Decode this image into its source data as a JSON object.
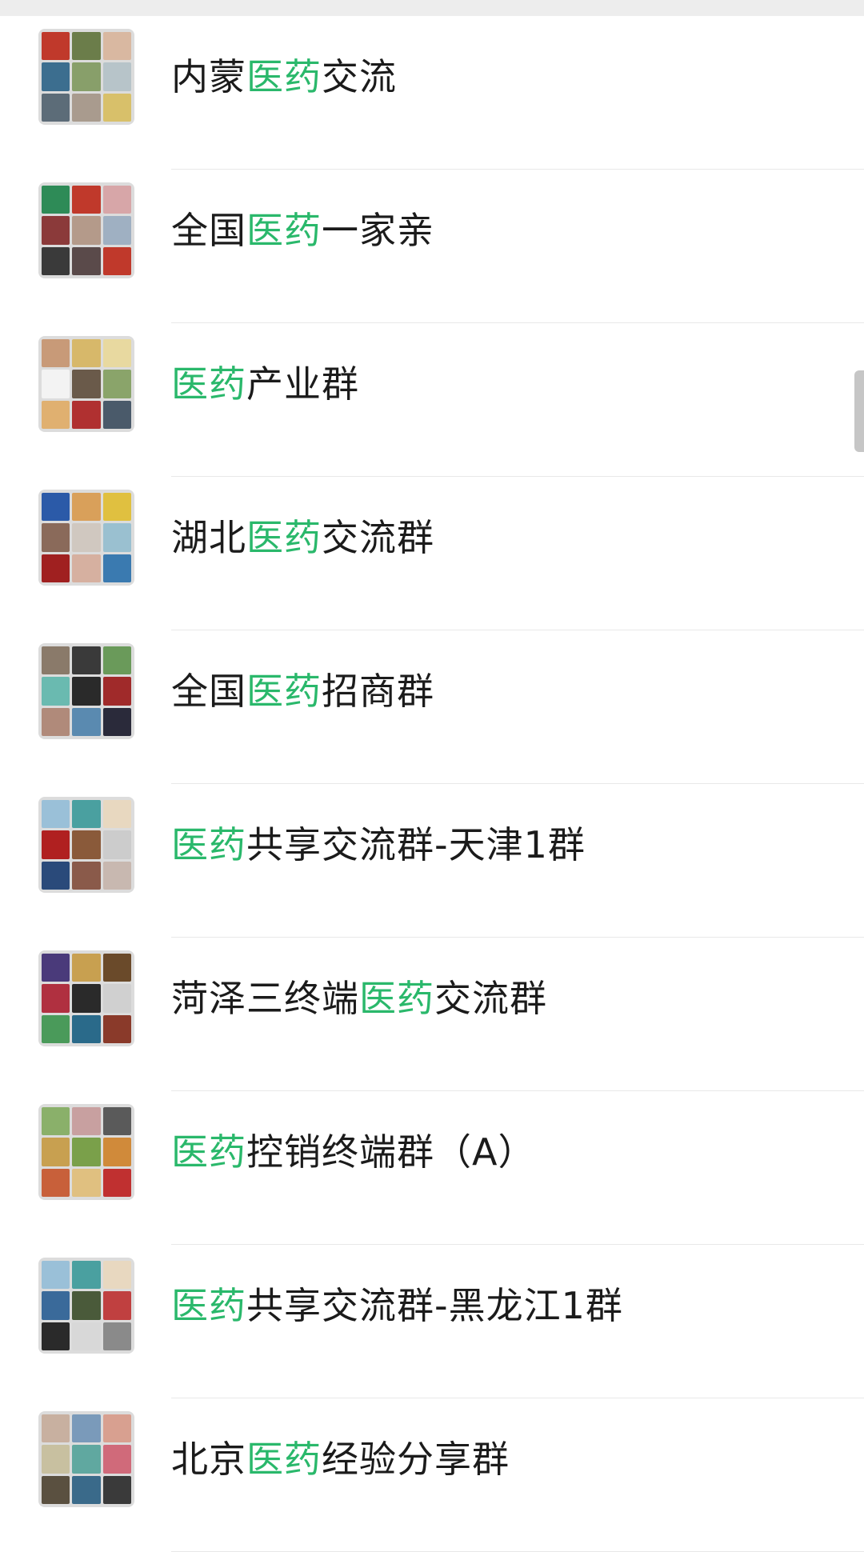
{
  "groups": [
    {
      "pre": "内蒙",
      "hl": "医药",
      "post": "交流",
      "colors": [
        "#c0392b",
        "#6b7d4a",
        "#d9b8a1",
        "#3c6e8f",
        "#889f6a",
        "#b7c4c9",
        "#5c6c78",
        "#a99b8e",
        "#d8c06a"
      ]
    },
    {
      "pre": "全国",
      "hl": "医药",
      "post": "一家亲",
      "colors": [
        "#2e8b57",
        "#c0392b",
        "#d7a6a8",
        "#8b3a3a",
        "#b49a8a",
        "#9fb0c2",
        "#3a3a3a",
        "#5a4a4a",
        "#c0392b"
      ]
    },
    {
      "pre": "",
      "hl": "医药",
      "post": "产业群",
      "colors": [
        "#c89a78",
        "#d7b86a",
        "#e8d9a0",
        "#f3f3f3",
        "#6a5a4a",
        "#8aa46a",
        "#e0b070",
        "#b03030",
        "#4a5a6a"
      ]
    },
    {
      "pre": "湖北",
      "hl": "医药",
      "post": "交流群",
      "colors": [
        "#2b5aa8",
        "#d9a05a",
        "#e0c040",
        "#8a6a5a",
        "#d0c8c0",
        "#9ac0d0",
        "#a02020",
        "#d6b0a0",
        "#3a7ab0"
      ]
    },
    {
      "pre": "全国",
      "hl": "医药",
      "post": "招商群",
      "colors": [
        "#8a7a6a",
        "#3a3a3a",
        "#6a9a5a",
        "#6abab0",
        "#2a2a2a",
        "#a02a2a",
        "#b08a7a",
        "#5a8ab0",
        "#2a2a3a"
      ]
    },
    {
      "pre": "",
      "hl": "医药",
      "post": "共享交流群-天津1群",
      "colors": [
        "#9ac0d8",
        "#4aa0a0",
        "#e8d8c0",
        "#b02020",
        "#8a5a3a",
        "#cccccc",
        "#2a4a7a",
        "#8a5a4a",
        "#c8b8b0"
      ]
    },
    {
      "pre": "菏泽三终端",
      "hl": "医药",
      "post": "交流群",
      "colors": [
        "#4a3a7a",
        "#c8a050",
        "#6a4a2a",
        "#b03040",
        "#2a2a2a",
        "#d0d0d0",
        "#4a9a5a",
        "#2a6a8a",
        "#8a3a2a"
      ]
    },
    {
      "pre": "",
      "hl": "医药",
      "post": "控销终端群（A）",
      "colors": [
        "#8ab06a",
        "#c8a0a0",
        "#5a5a5a",
        "#c8a050",
        "#7aa04a",
        "#d08a3a",
        "#c8603a",
        "#e0c080",
        "#c03030"
      ]
    },
    {
      "pre": "",
      "hl": "医药",
      "post": "共享交流群-黑龙江1群",
      "colors": [
        "#9ac0d8",
        "#4aa0a0",
        "#e8d8c0",
        "#3a6a9a",
        "#4a5a3a",
        "#c04040",
        "#2a2a2a",
        "#d8d8d8",
        "#8a8a8a"
      ]
    },
    {
      "pre": "北京",
      "hl": "医药",
      "post": "经验分享群",
      "colors": [
        "#c8b0a0",
        "#7a9aba",
        "#d8a090",
        "#c8c0a0",
        "#60a8a0",
        "#d06a7a",
        "#5a5040",
        "#3a6a8a",
        "#3a3a3a"
      ]
    }
  ],
  "accent_color": "#2ab86b"
}
